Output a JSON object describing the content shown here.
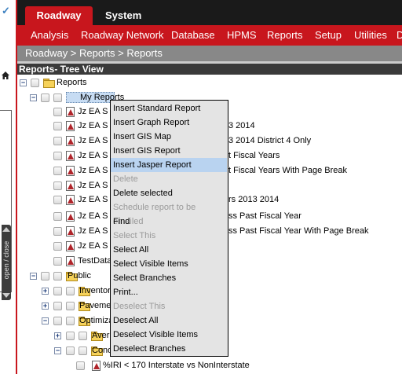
{
  "topTabs": {
    "roadway": "Roadway",
    "system": "System"
  },
  "nav": [
    "Analysis",
    "Roadway Network",
    "Database",
    "HPMS",
    "Reports",
    "Setup",
    "Utilities",
    "D"
  ],
  "breadcrumb": "Roadway > Reports > Reports",
  "treeHeader": "Reports- Tree View",
  "sidePanel": {
    "toggle": "open / close"
  },
  "tree": {
    "root": "Reports",
    "myReports": "My Reports",
    "items": [
      "Jz EA S",
      "Jz EA S",
      "Jz EA S",
      "Jz EA S",
      "Jz EA S",
      "Jz EA S",
      "Jz EA S",
      "Jz EA S",
      "Jz EA S",
      "Jz EA S",
      "TestData"
    ],
    "suffixes": {
      "s1": "3 2014",
      "s2": "3 2014 District 4 Only",
      "s3": "t Fiscal Years",
      "s4": "t Fiscal Years With Page Break",
      "s5": "rs 2013 2014",
      "s6": "ss Past Fiscal Year",
      "s7": "ss Past Fiscal Year With Page Break"
    },
    "public": "Public",
    "inventory": "Inventor",
    "pavement": "Paveme",
    "optimization": "Optimiza",
    "average": "Aver",
    "condition": "Cond",
    "iriReport": "%IRI < 170 Interstate vs NonInterstate"
  },
  "contextMenu": [
    {
      "label": "Insert Standard Report",
      "state": "enabled"
    },
    {
      "label": "Insert Graph Report",
      "state": "enabled"
    },
    {
      "label": "Insert GIS Map",
      "state": "enabled"
    },
    {
      "label": "Insert GIS Report",
      "state": "enabled"
    },
    {
      "label": "Insert Jasper Report",
      "state": "highlighted"
    },
    {
      "label": "Delete",
      "state": "disabled"
    },
    {
      "label": "Delete selected",
      "state": "enabled"
    },
    {
      "label": "Schedule report to be emailed",
      "state": "disabled"
    },
    {
      "label": "Find",
      "state": "enabled"
    },
    {
      "label": "Select This",
      "state": "disabled"
    },
    {
      "label": "Select All",
      "state": "enabled"
    },
    {
      "label": "Select Visible Items",
      "state": "enabled"
    },
    {
      "label": "Select Branches",
      "state": "enabled"
    },
    {
      "label": "Print...",
      "state": "enabled"
    },
    {
      "label": "Deselect This",
      "state": "disabled"
    },
    {
      "label": "Deselect All",
      "state": "enabled"
    },
    {
      "label": "Deselect Visible Items",
      "state": "enabled"
    },
    {
      "label": "Deselect Branches",
      "state": "enabled"
    }
  ],
  "colors": {
    "brandRed": "#c8161d",
    "topBar": "#1a1a1a",
    "breadcrumbBg": "#888888",
    "menuHighlight": "#b9d3f0"
  }
}
